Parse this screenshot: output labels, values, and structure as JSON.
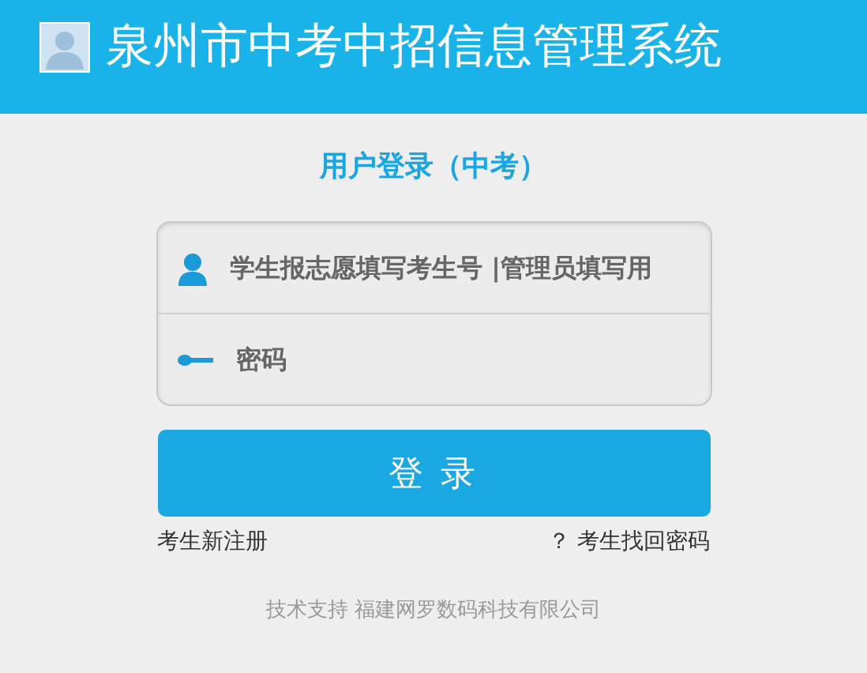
{
  "header": {
    "title": "泉州市中考中招信息管理系统"
  },
  "login": {
    "heading": "用户登录（中考）",
    "fields": [
      {
        "kind": "user",
        "placeholder": "学生报志愿填写考生号 |管理员填写用"
      },
      {
        "kind": "password",
        "placeholder": "密码"
      }
    ],
    "submit": "登 录",
    "register_link": "考生新注册",
    "recover_link": "？ 考生找回密码"
  },
  "footer": "技术支持 福建网罗数码科技有限公司"
}
